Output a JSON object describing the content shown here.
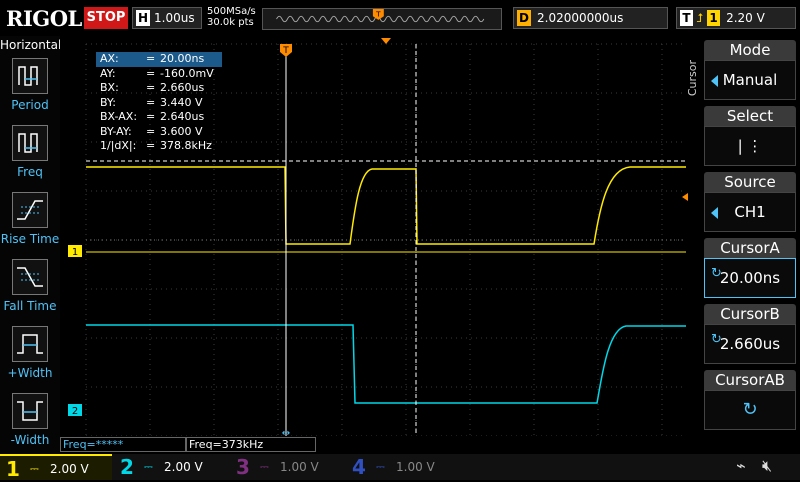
{
  "topbar": {
    "logo": "RIGOL",
    "run_state": "STOP",
    "h_label": "H",
    "timebase": "1.00us",
    "sample_rate": "500MSa/s",
    "mem_depth": "30.0k pts",
    "d_label": "D",
    "delay": "2.02000000us",
    "t_label": "T",
    "trigger_channel": "1",
    "trigger_level": "2.20 V"
  },
  "left_panel": {
    "title": "Horizontal",
    "items": [
      {
        "label": "Period",
        "icon": "period-icon"
      },
      {
        "label": "Freq",
        "icon": "freq-icon"
      },
      {
        "label": "Rise Time",
        "icon": "rise-time-icon"
      },
      {
        "label": "Fall Time",
        "icon": "fall-time-icon"
      },
      {
        "label": "+Width",
        "icon": "pos-width-icon"
      },
      {
        "label": "-Width",
        "icon": "neg-width-icon"
      }
    ]
  },
  "cursor_table": [
    {
      "key": "AX:",
      "value": "20.00ns"
    },
    {
      "key": "AY:",
      "value": "-160.0mV"
    },
    {
      "key": "BX:",
      "value": "2.660us"
    },
    {
      "key": "BY:",
      "value": "3.440 V"
    },
    {
      "key": "BX-AX:",
      "value": "2.640us"
    },
    {
      "key": "BY-AY:",
      "value": "3.600 V"
    },
    {
      "key": "1/|dX|:",
      "value": "378.8kHz"
    }
  ],
  "cursor_eq": "=",
  "markers": {
    "trigger_top": "T",
    "ch1": "1",
    "ch2": "2"
  },
  "right_menu": {
    "side_label": "Cursor",
    "items": [
      {
        "title": "Mode",
        "value": "Manual"
      },
      {
        "title": "Select",
        "value": "|  ⋮"
      },
      {
        "title": "Source",
        "value": "CH1"
      },
      {
        "title": "CursorA",
        "value": "20.00ns"
      },
      {
        "title": "CursorB",
        "value": "2.660us"
      },
      {
        "title": "CursorAB",
        "value": ""
      }
    ]
  },
  "freq_bar": {
    "left": "Freq=*****",
    "right": "Freq=373kHz"
  },
  "channels": [
    {
      "num": "1",
      "scale": "2.00 V",
      "color": "#ffea00"
    },
    {
      "num": "2",
      "scale": "2.00 V",
      "color": "#00d8e8"
    },
    {
      "num": "3",
      "scale": "1.00 V",
      "color": "#c040c0"
    },
    {
      "num": "4",
      "scale": "1.00 V",
      "color": "#2a5cff"
    }
  ],
  "colors": {
    "ch1": "#ffea00",
    "ch2": "#00d8e8",
    "accent": "#4fc3f7",
    "trigger": "#ff8c00",
    "stop": "#d01818"
  }
}
